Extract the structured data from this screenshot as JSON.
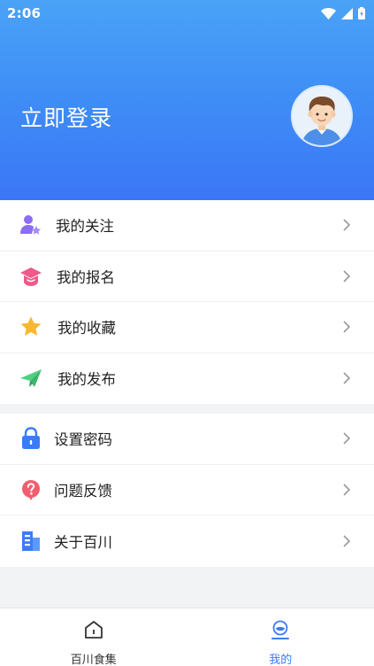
{
  "status_bar": {
    "time": "2:06"
  },
  "header": {
    "login_text": "立即登录"
  },
  "menu_group_1": [
    {
      "label": "我的关注",
      "icon": "user-star-icon"
    },
    {
      "label": "我的报名",
      "icon": "graduation-cap-icon"
    },
    {
      "label": "我的收藏",
      "icon": "star-icon"
    },
    {
      "label": "我的发布",
      "icon": "paper-plane-icon"
    }
  ],
  "menu_group_2": [
    {
      "label": "设置密码",
      "icon": "lock-icon"
    },
    {
      "label": "问题反馈",
      "icon": "question-bubble-icon"
    },
    {
      "label": "关于百川",
      "icon": "building-icon"
    }
  ],
  "tabbar": {
    "home_label": "百川食集",
    "mine_label": "我的"
  },
  "colors": {
    "header_top": "#4aa3f7",
    "header_bottom": "#3b76f6",
    "accent": "#3b7cf6"
  }
}
